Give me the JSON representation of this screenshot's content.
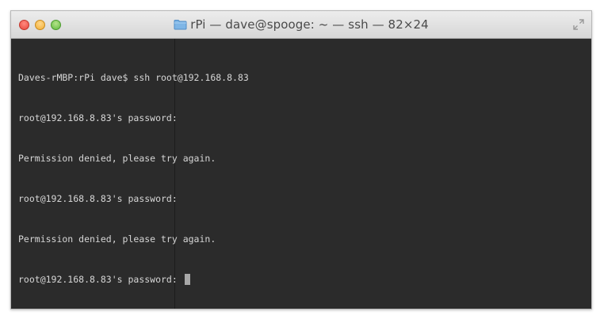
{
  "window": {
    "title": "rPi — dave@spooge: ~ — ssh — 82×24"
  },
  "terminal": {
    "lines": [
      "Daves-rMBP:rPi dave$ ssh root@192.168.8.83",
      "root@192.168.8.83's password:",
      "Permission denied, please try again.",
      "root@192.168.8.83's password:",
      "Permission denied, please try again.",
      "root@192.168.8.83's password: "
    ]
  },
  "colors": {
    "terminal_background": "#2b2b2b",
    "terminal_text": "#d6d6d6"
  },
  "icons": {
    "title_icon": "folder-icon",
    "fullscreen": "fullscreen-icon"
  }
}
